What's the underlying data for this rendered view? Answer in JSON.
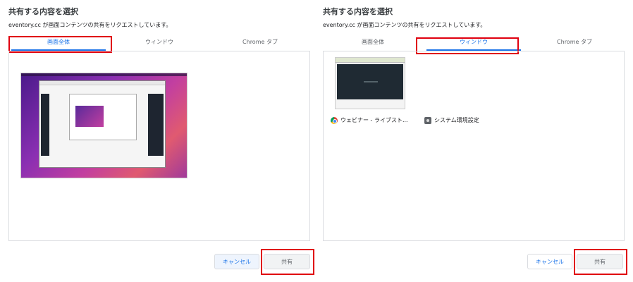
{
  "left": {
    "title": "共有する内容を選択",
    "subtitle": "eventory.cc が画面コンテンツの共有をリクエストしています。",
    "tabs": [
      "画面全体",
      "ウィンドウ",
      "Chrome タブ"
    ],
    "buttons": {
      "cancel": "キャンセル",
      "share": "共有"
    }
  },
  "right": {
    "title": "共有する内容を選択",
    "subtitle": "eventory.cc が画面コンテンツの共有をリクエストしています。",
    "tabs": [
      "画面全体",
      "ウィンドウ",
      "Chrome タブ"
    ],
    "windows": [
      {
        "label": "ウェビナー - ライブスト...",
        "icon": "chrome-icon"
      },
      {
        "label": "システム環境設定",
        "icon": "gear-icon"
      }
    ],
    "buttons": {
      "cancel": "キャンセル",
      "share": "共有"
    }
  },
  "colors": {
    "accent": "#1a73e8",
    "highlight": "#e0000f"
  }
}
